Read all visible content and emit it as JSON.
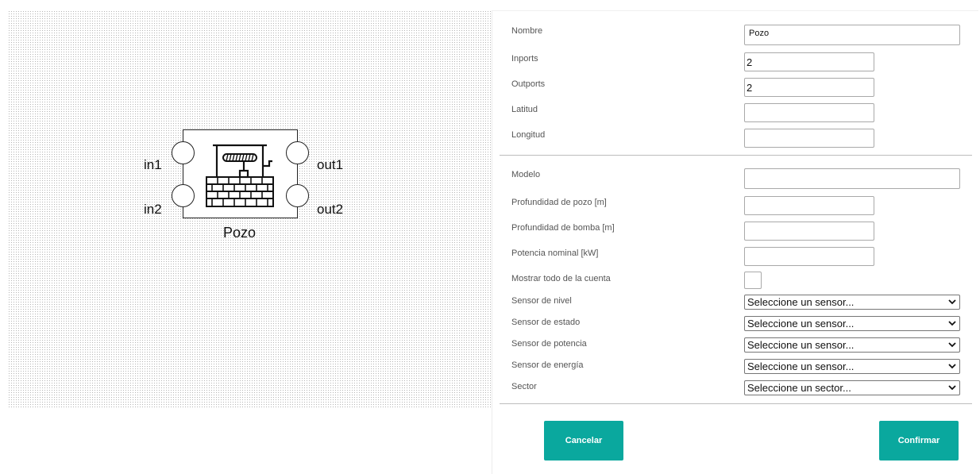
{
  "diagram": {
    "block_name": "Pozo",
    "ports": {
      "in1": "in1",
      "in2": "in2",
      "out1": "out1",
      "out2": "out2"
    },
    "icon": "well-icon"
  },
  "form": {
    "nombre": {
      "label": "Nombre",
      "value": "Pozo"
    },
    "inports": {
      "label": "Inports",
      "value": "2"
    },
    "outports": {
      "label": "Outports",
      "value": "2"
    },
    "latitud": {
      "label": "Latitud",
      "value": ""
    },
    "longitud": {
      "label": "Longitud",
      "value": ""
    },
    "modelo": {
      "label": "Modelo",
      "value": ""
    },
    "prof_pozo": {
      "label": "Profundidad de pozo [m]",
      "value": ""
    },
    "prof_bomba": {
      "label": "Profundidad de bomba [m]",
      "value": ""
    },
    "potencia": {
      "label": "Potencia nominal [kW]",
      "value": ""
    },
    "mostrar": {
      "label": "Mostrar todo de la cuenta"
    },
    "sensor_nivel": {
      "label": "Sensor de nivel",
      "value": "Seleccione un sensor..."
    },
    "sensor_estado": {
      "label": "Sensor de estado",
      "value": "Seleccione un sensor..."
    },
    "sensor_potencia": {
      "label": "Sensor de potencia",
      "value": "Seleccione un sensor..."
    },
    "sensor_energia": {
      "label": "Sensor de energía",
      "value": "Seleccione un sensor..."
    },
    "sector": {
      "label": "Sector",
      "value": "Seleccione un sector..."
    }
  },
  "buttons": {
    "cancel": "Cancelar",
    "confirm": "Confirmar"
  },
  "colors": {
    "accent": "#0aa89e"
  }
}
